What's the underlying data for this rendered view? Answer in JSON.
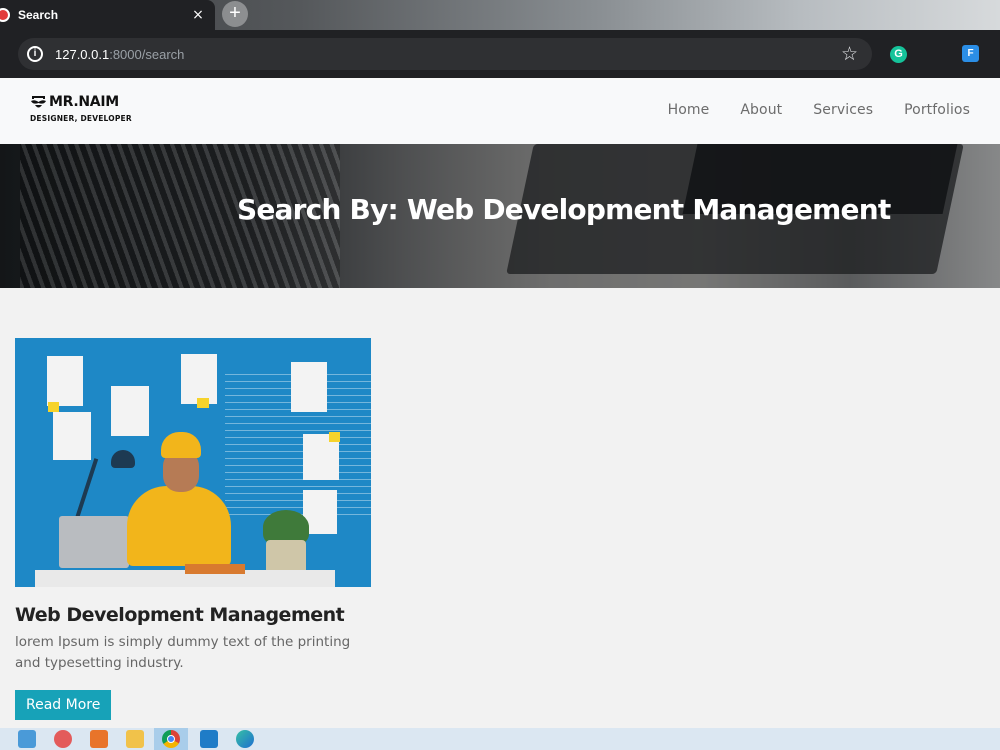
{
  "browser": {
    "tab_title": "Search",
    "tab_close": "×",
    "new_tab": "+",
    "url_host": "127.0.0.1",
    "url_rest": ":8000/search",
    "info_glyph": "i",
    "star_glyph": "☆",
    "ext_grammarly": "G",
    "ext_other": "F"
  },
  "navbar": {
    "logo_name": "MR.NAIM",
    "logo_tagline": "DESIGNER, DEVELOPER",
    "links": [
      "Home",
      "About",
      "Services",
      "Portfolios"
    ]
  },
  "hero": {
    "title": "Search By: Web Development Management"
  },
  "results": [
    {
      "title": "Web Development Management",
      "excerpt": "lorem Ipsum is simply dummy text of the printing and typesetting industry.",
      "button": "Read More"
    }
  ],
  "taskbar": {
    "icons": [
      "file-explorer-icon",
      "paint-icon",
      "xampp-icon",
      "folder-icon",
      "chrome-icon",
      "vscode-icon",
      "edge-icon"
    ]
  },
  "colors": {
    "accent": "#17a2b8",
    "browser_dark": "#202124",
    "navbar_bg": "#f8f9fa"
  }
}
